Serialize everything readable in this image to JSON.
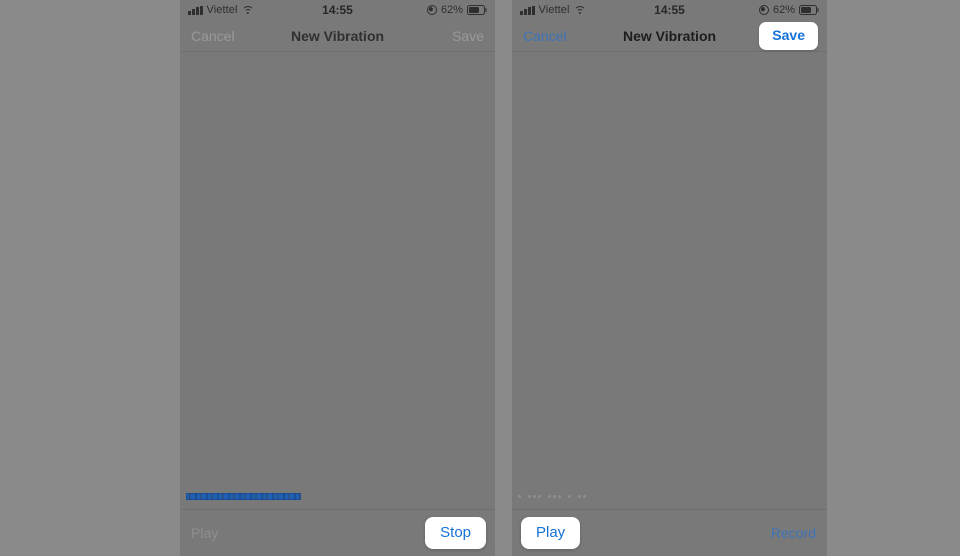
{
  "panels": [
    {
      "id": "left",
      "status_bar": {
        "carrier": "Viettel",
        "time": "14:55",
        "battery_pct": "62%",
        "signal_icon": "cellular-signal-icon",
        "wifi_icon": "wifi-icon",
        "location_icon": "location-arrow-icon",
        "battery_icon": "battery-icon",
        "battery_level": 62
      },
      "nav": {
        "cancel_label": "Cancel",
        "title": "New Vibration",
        "save_label": "Save",
        "cancel_state": "disabled",
        "save_state": "disabled"
      },
      "waveform": {
        "mode": "recorded-bar",
        "fill_percent": 38,
        "color": "#1f5fae"
      },
      "toolbar": {
        "left_label": "Play",
        "left_state": "disabled",
        "right_label": "Stop",
        "right_state": "highlighted"
      }
    },
    {
      "id": "right",
      "status_bar": {
        "carrier": "Viettel",
        "time": "14:55",
        "battery_pct": "62%",
        "signal_icon": "cellular-signal-icon",
        "wifi_icon": "wifi-icon",
        "location_icon": "location-arrow-icon",
        "battery_icon": "battery-icon",
        "battery_level": 62
      },
      "nav": {
        "cancel_label": "Cancel",
        "title": "New Vibration",
        "save_label": "Save",
        "cancel_state": "enabled",
        "save_state": "highlighted"
      },
      "waveform": {
        "mode": "dot-pattern",
        "dots": "9",
        "color": "#8e8e8e"
      },
      "toolbar": {
        "left_label": "Play",
        "left_state": "highlighted",
        "right_label": "Record",
        "right_state": "enabled"
      }
    }
  ],
  "colors": {
    "accent_blue": "#1572d8",
    "muted_blue": "#3d74b8",
    "panel_bg": "#797979",
    "page_bg": "#8a8a8a",
    "highlight_bg": "#ffffff",
    "waveform_blue": "#1f5fae"
  }
}
